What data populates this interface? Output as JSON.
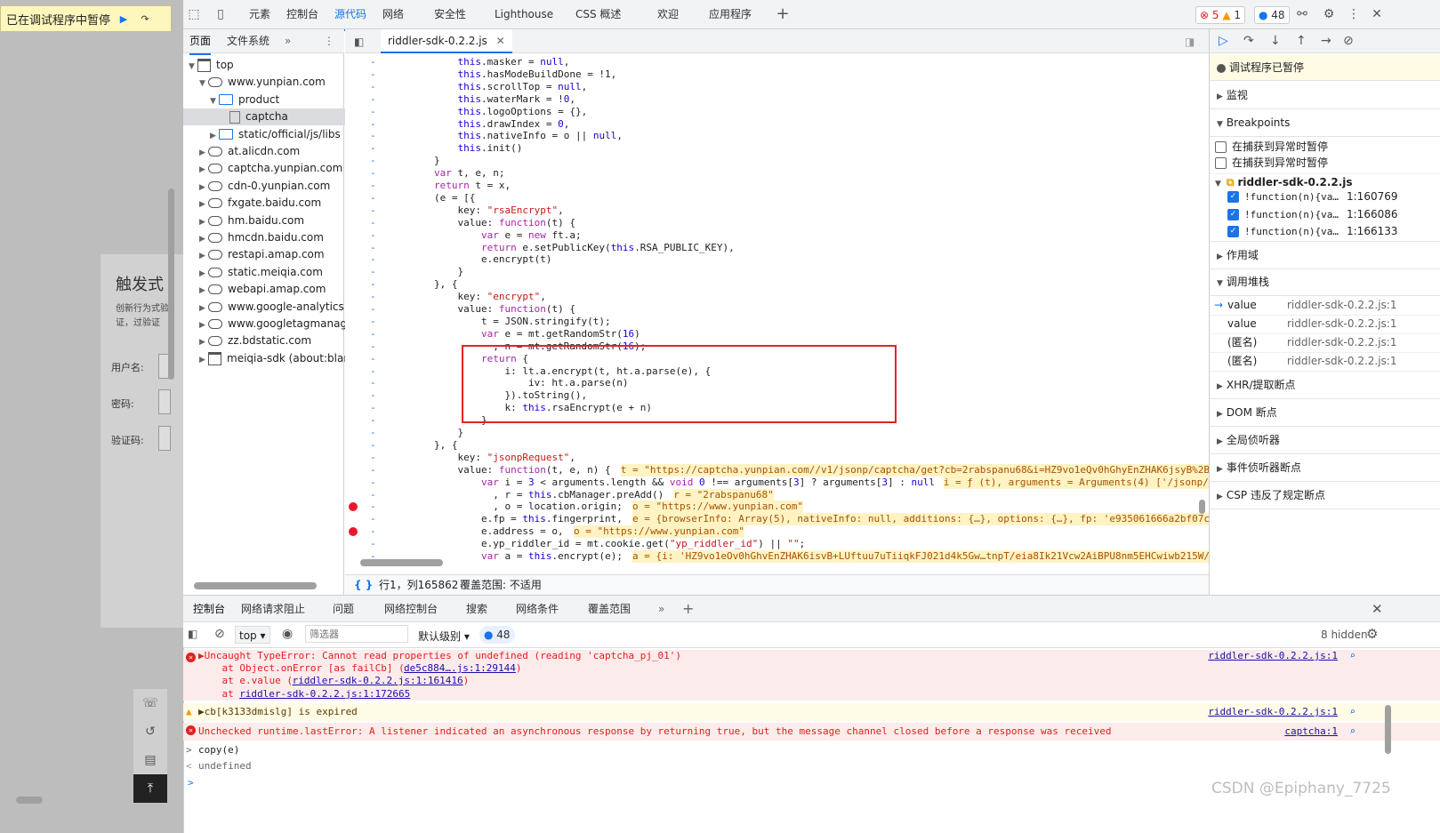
{
  "page": {
    "paused_label": "已在调试程序中暂停",
    "login_title": "触发式",
    "login_subtitle": "创新行为式验证，过验证",
    "username_label": "用户名:",
    "password_label": "密码:",
    "captcha_label": "验证码:"
  },
  "toolbar": {
    "tabs": [
      "元素",
      "控制台",
      "源代码",
      "网络",
      "安全性",
      "Lighthouse",
      "CSS 概述",
      "欢迎",
      "应用程序"
    ],
    "active_tab": "源代码",
    "error_count": "5",
    "warning_count": "1",
    "info_count": "48"
  },
  "navigator": {
    "tabs": [
      "页面",
      "文件系统"
    ],
    "tree": [
      {
        "label": "top",
        "icon": "frame",
        "depth": 0,
        "open": true
      },
      {
        "label": "www.yunpian.com",
        "icon": "cloud",
        "depth": 1,
        "open": true
      },
      {
        "label": "product",
        "icon": "folder",
        "depth": 2,
        "open": true
      },
      {
        "label": "captcha",
        "icon": "file",
        "depth": 3,
        "selected": true
      },
      {
        "label": "static/official/js/libs",
        "icon": "folder",
        "depth": 2
      },
      {
        "label": "at.alicdn.com",
        "icon": "cloud",
        "depth": 1
      },
      {
        "label": "captcha.yunpian.com",
        "icon": "cloud",
        "depth": 1
      },
      {
        "label": "cdn-0.yunpian.com",
        "icon": "cloud",
        "depth": 1
      },
      {
        "label": "fxgate.baidu.com",
        "icon": "cloud",
        "depth": 1
      },
      {
        "label": "hm.baidu.com",
        "icon": "cloud",
        "depth": 1
      },
      {
        "label": "hmcdn.baidu.com",
        "icon": "cloud",
        "depth": 1
      },
      {
        "label": "restapi.amap.com",
        "icon": "cloud",
        "depth": 1
      },
      {
        "label": "static.meiqia.com",
        "icon": "cloud",
        "depth": 1
      },
      {
        "label": "webapi.amap.com",
        "icon": "cloud",
        "depth": 1
      },
      {
        "label": "www.google-analytics.com",
        "icon": "cloud",
        "depth": 1
      },
      {
        "label": "www.googletagmanager.com",
        "icon": "cloud",
        "depth": 1
      },
      {
        "label": "zz.bdstatic.com",
        "icon": "cloud",
        "depth": 1
      },
      {
        "label": "meiqia-sdk (about:blank)",
        "icon": "frame",
        "depth": 1
      }
    ]
  },
  "editor": {
    "file_tab": "riddler-sdk-0.2.2.js",
    "status_position": "行1，列165862",
    "status_coverage": "覆盖范围: 不适用",
    "lines": [
      "            this.masker = null,",
      "            this.hasModeBuildDone = !1,",
      "            this.scrollTop = null,",
      "            this.waterMark = !0,",
      "            this.logoOptions = {},",
      "            this.drawIndex = 0,",
      "            this.nativeInfo = o || null,",
      "            this.init()",
      "        }",
      "        var t, e, n;",
      "        return t = x,",
      "        (e = [{",
      "            key: \"rsaEncrypt\",",
      "            value: function(t) {",
      "                var e = new ft.a;",
      "                return e.setPublicKey(this.RSA_PUBLIC_KEY),",
      "                e.encrypt(t)",
      "            }",
      "        }, {",
      "            key: \"encrypt\",",
      "            value: function(t) {",
      "                t = JSON.stringify(t);",
      "                var e = mt.getRandomStr(16)",
      "                  , n = mt.getRandomStr(16);",
      "                return {",
      "                    i: lt.a.encrypt(t, ht.a.parse(e), {",
      "                        iv: ht.a.parse(n)",
      "                    }).toString(),",
      "                    k: this.rsaEncrypt(e + n)",
      "                }",
      "            }",
      "        }, {",
      "            key: \"jsonpRequest\",",
      "            value: function(t, e, n) {",
      "                var i = 3 < arguments.length && void 0 !== arguments[3] ? arguments[3] : null",
      "                  , r = this.cbManager.preAdd()",
      "                  , o = location.origin;",
      "                e.fp = this.fingerprint,",
      "                e.address = o,",
      "                e.yp_riddler_id = mt.cookie.get(\"yp_riddler_id\") || \"\";",
      "                var a = this.encrypt(e);"
    ],
    "inline_values": [
      {
        "line": 33,
        "text": "t = \"https://captcha.yunpian.com//v1/jsonp/captcha/get?cb=2rabspanu68&i=HZ9vo1eQv0hGhyEnZHAK6jsyB%2B"
      },
      {
        "line": 34,
        "text": "i = ƒ (t), arguments = Arguments(4) ['/jsonp/"
      },
      {
        "line": 35,
        "text": "r = \"2rabspanu68\""
      },
      {
        "line": 36,
        "text": "o = \"https://www.yunpian.com\""
      },
      {
        "line": 37,
        "text": "e = {browserInfo: Array(5), nativeInfo: null, additions: {…}, options: {…}, fp: 'e935061666a2bf07c"
      },
      {
        "line": 38,
        "text": "o = \"https://www.yunpian.com\""
      },
      {
        "line": 40,
        "text": "a = {i: 'HZ9vo1eOv0hGhvEnZHAK6isvB+LUftuu7uTiiqkFJ021d4k5Gw…tnpT/eia8Ik21Vcw2AiBPU8nm5EHCwiwb215W/"
      }
    ]
  },
  "debugger": {
    "paused_title": "调试程序已暂停",
    "sections": {
      "watch": "监视",
      "breakpoints": "Breakpoints",
      "scope": "作用域",
      "callstack": "调用堆栈",
      "xhr": "XHR/提取断点",
      "dom": "DOM 断点",
      "global": "全局侦听器",
      "event": "事件侦听器断点",
      "csp": "CSP 违反了规定断点"
    },
    "pause_on_caught": "在捕获到异常时暂停",
    "pause_on_uncaught": "在捕获到异常时暂停",
    "bp_file": "riddler-sdk-0.2.2.js",
    "bp_items": [
      {
        "code": "!function(n){va…",
        "loc": "1:160769"
      },
      {
        "code": "!function(n){va…",
        "loc": "1:166086"
      },
      {
        "code": "!function(n){va…",
        "loc": "1:166133"
      }
    ],
    "call_stack": [
      {
        "fn": "value",
        "loc": "riddler-sdk-0.2.2.js:1",
        "current": true
      },
      {
        "fn": "value",
        "loc": "riddler-sdk-0.2.2.js:1"
      },
      {
        "fn": "(匿名)",
        "loc": "riddler-sdk-0.2.2.js:1"
      },
      {
        "fn": "(匿名)",
        "loc": "riddler-sdk-0.2.2.js:1"
      }
    ]
  },
  "drawer": {
    "tabs": [
      "控制台",
      "网络请求阻止",
      "问题",
      "网络控制台",
      "搜索",
      "网络条件",
      "覆盖范围"
    ],
    "context": "top",
    "filter_placeholder": "筛选器",
    "level": "默认级别",
    "msg_count": "48",
    "hidden": "8 hidden"
  },
  "console": {
    "messages": [
      {
        "type": "error",
        "text": "▶Uncaught TypeError: Cannot read properties of undefined (reading 'captcha_pj_01')",
        "src": "riddler-sdk-0.2.2.js:1"
      },
      {
        "type": "trace",
        "text": "    at Object.onError [as failCb] (",
        "link": "de5c884….js:1:29144",
        "after": ")"
      },
      {
        "type": "trace",
        "text": "    at e.value (",
        "link": "riddler-sdk-0.2.2.js:1:161416",
        "after": ")"
      },
      {
        "type": "trace",
        "text": "    at ",
        "link": "riddler-sdk-0.2.2.js:1:172665",
        "after": ""
      },
      {
        "type": "warn",
        "text": "▶cb[k3133dmislg] is expired",
        "src": "riddler-sdk-0.2.2.js:1"
      },
      {
        "type": "error",
        "text": "Unchecked runtime.lastError: A listener indicated an asynchronous response by returning true, but the message channel closed before a response was received",
        "src": "captcha:1"
      },
      {
        "type": "input",
        "text": "copy(e)"
      },
      {
        "type": "output",
        "text": "undefined"
      }
    ]
  },
  "watermark": "CSDN @Epiphany_7725",
  "colors": {
    "accent": "#1a73e8",
    "error": "#e02020",
    "highlight_box": "#e52222"
  }
}
